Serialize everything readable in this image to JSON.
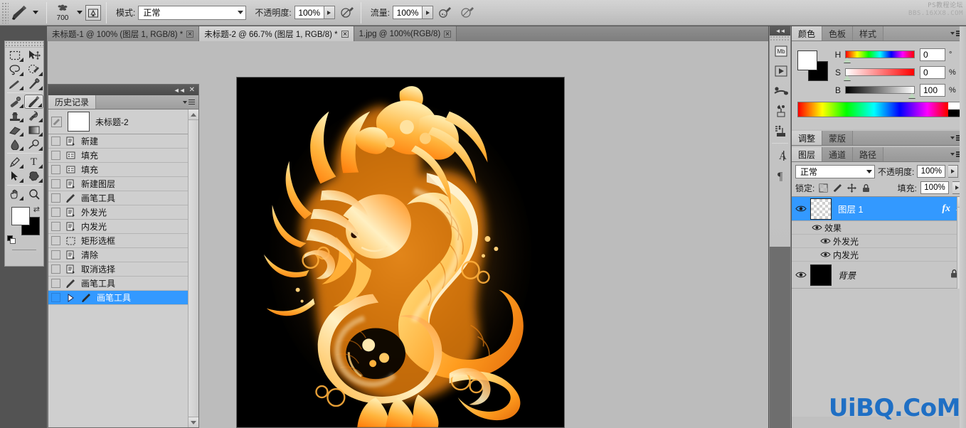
{
  "app": {
    "name": "Adobe Photoshop",
    "watermark_top_line1": "PS教程论坛",
    "watermark_top_line2": "BBS.16XX8.COM",
    "watermark_bottom": "UiBQ.CoM"
  },
  "options_bar": {
    "tool_icon": "brush-icon",
    "brush_size": "700",
    "brush_preset_icon": "brush-preset-icon",
    "brush_panel_icon": "brush-panel-toggle-icon",
    "mode_label": "模式:",
    "mode_value": "正常",
    "opacity_label": "不透明度:",
    "opacity_value": "100%",
    "opacity_airbrush_icon": "airbrush-pressure-icon",
    "flow_label": "流量:",
    "flow_value": "100%",
    "flow_airbrush_icon": "airbrush-icon",
    "tablet_pressure_icon": "tablet-pressure-icon"
  },
  "tabs": [
    {
      "label": "未标题-1 @ 100% (图层 1, RGB/8) *",
      "active": false
    },
    {
      "label": "未标题-2 @ 66.7% (图层 1, RGB/8) *",
      "active": true
    },
    {
      "label": "1.jpg @ 100%(RGB/8)",
      "active": false
    }
  ],
  "toolbar": {
    "tools": [
      {
        "name": "rectangular-marquee-tool",
        "glyph": "marquee",
        "has_submenu": true,
        "selected": false
      },
      {
        "name": "move-tool",
        "glyph": "move",
        "has_submenu": false,
        "selected": false
      },
      {
        "name": "lasso-tool",
        "glyph": "lasso",
        "has_submenu": true,
        "selected": false
      },
      {
        "name": "quick-selection-tool",
        "glyph": "quickselect",
        "has_submenu": true,
        "selected": false
      },
      {
        "name": "crop-tool",
        "glyph": "crop",
        "has_submenu": true,
        "selected": false
      },
      {
        "name": "eyedropper-tool",
        "glyph": "eyedropper",
        "has_submenu": true,
        "selected": false
      },
      {
        "name": "spot-healing-brush-tool",
        "glyph": "healing",
        "has_submenu": true,
        "selected": false
      },
      {
        "name": "brush-tool",
        "glyph": "brush",
        "has_submenu": true,
        "selected": true
      },
      {
        "name": "clone-stamp-tool",
        "glyph": "stamp",
        "has_submenu": true,
        "selected": false
      },
      {
        "name": "history-brush-tool",
        "glyph": "historybrush",
        "has_submenu": true,
        "selected": false
      },
      {
        "name": "eraser-tool",
        "glyph": "eraser",
        "has_submenu": true,
        "selected": false
      },
      {
        "name": "gradient-tool",
        "glyph": "gradient",
        "has_submenu": true,
        "selected": false
      },
      {
        "name": "blur-tool",
        "glyph": "blur",
        "has_submenu": true,
        "selected": false
      },
      {
        "name": "dodge-tool",
        "glyph": "dodge",
        "has_submenu": true,
        "selected": false
      },
      {
        "name": "pen-tool",
        "glyph": "pen",
        "has_submenu": true,
        "selected": false
      },
      {
        "name": "type-tool",
        "glyph": "type",
        "has_submenu": true,
        "selected": false
      },
      {
        "name": "path-selection-tool",
        "glyph": "pathselect",
        "has_submenu": true,
        "selected": false
      },
      {
        "name": "custom-shape-tool",
        "glyph": "shape",
        "has_submenu": true,
        "selected": false
      },
      {
        "name": "hand-tool",
        "glyph": "hand",
        "has_submenu": true,
        "selected": false
      },
      {
        "name": "zoom-tool",
        "glyph": "zoom",
        "has_submenu": false,
        "selected": false
      }
    ],
    "foreground_color": "#ffffff",
    "background_color": "#000000"
  },
  "history_panel": {
    "title": "历史记录",
    "snapshot": {
      "label": "未标题-2",
      "icon": "history-brush-source-icon"
    },
    "items": [
      {
        "label": "新建",
        "icon": "document-icon",
        "selected": false
      },
      {
        "label": "填充",
        "icon": "fill-icon",
        "selected": false
      },
      {
        "label": "填充",
        "icon": "fill-icon",
        "selected": false
      },
      {
        "label": "新建图层",
        "icon": "document-icon",
        "selected": false
      },
      {
        "label": "画笔工具",
        "icon": "brush-icon",
        "selected": false
      },
      {
        "label": "外发光",
        "icon": "document-icon",
        "selected": false
      },
      {
        "label": "内发光",
        "icon": "document-icon",
        "selected": false
      },
      {
        "label": "矩形选框",
        "icon": "marquee-icon",
        "selected": false
      },
      {
        "label": "清除",
        "icon": "document-icon",
        "selected": false
      },
      {
        "label": "取消选择",
        "icon": "document-icon",
        "selected": false
      },
      {
        "label": "画笔工具",
        "icon": "brush-icon",
        "selected": false
      },
      {
        "label": "画笔工具",
        "icon": "brush-icon",
        "selected": true
      }
    ]
  },
  "icon_dock": {
    "buttons": [
      {
        "name": "mini-bridge-icon",
        "glyph": "Mb"
      },
      {
        "name": "play-icon",
        "glyph": "play"
      },
      {
        "name": "brushes-icon",
        "glyph": "brush"
      },
      {
        "name": "clone-source-icon",
        "glyph": "clone"
      },
      {
        "name": "swatches-list-icon",
        "glyph": "list"
      },
      {
        "name": "character-icon",
        "glyph": "A"
      },
      {
        "name": "paragraph-icon",
        "glyph": "pilcrow"
      }
    ]
  },
  "color_panel": {
    "tabs": [
      {
        "label": "颜色",
        "active": true
      },
      {
        "label": "色板",
        "active": false
      },
      {
        "label": "样式",
        "active": false
      }
    ],
    "foreground_color": "#ffffff",
    "background_color": "#000000",
    "sliders": [
      {
        "channel": "H",
        "value": "0",
        "unit": "°",
        "pos": 2
      },
      {
        "channel": "S",
        "value": "0",
        "unit": "%",
        "pos": 2
      },
      {
        "channel": "B",
        "value": "100",
        "unit": "%",
        "pos": 96
      }
    ]
  },
  "adjustments_panel": {
    "tabs": [
      {
        "label": "调整",
        "active": true
      },
      {
        "label": "蒙版",
        "active": false
      }
    ]
  },
  "layers_panel": {
    "tabs": [
      {
        "label": "图层",
        "active": true
      },
      {
        "label": "通道",
        "active": false
      },
      {
        "label": "路径",
        "active": false
      }
    ],
    "blend_mode": "正常",
    "opacity_label": "不透明度:",
    "opacity_value": "100%",
    "lock_label": "锁定:",
    "lock_icons": [
      "lock-transparent-pixels-icon",
      "lock-image-pixels-icon",
      "lock-position-icon",
      "lock-all-icon"
    ],
    "fill_label": "填充:",
    "fill_value": "100%",
    "layers": [
      {
        "name": "图层 1",
        "selected": true,
        "visible": true,
        "thumb": "transparent",
        "has_fx": true,
        "fx_label": "fx",
        "effects_group": "效果",
        "effects": [
          "外发光",
          "内发光"
        ]
      },
      {
        "name": "背景",
        "selected": false,
        "visible": true,
        "thumb": "black",
        "locked": true
      }
    ]
  },
  "canvas": {
    "document": "未标题-2",
    "zoom": "66.7%",
    "artwork": "golden-fire-dragon",
    "background_color": "#000000"
  }
}
